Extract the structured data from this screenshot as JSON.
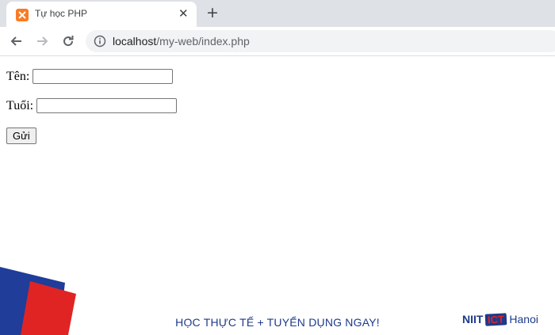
{
  "browser": {
    "tab": {
      "title": "Tự học PHP",
      "favicon": "xampp-icon",
      "close_symbol": "✕"
    },
    "new_tab_symbol": "+",
    "url_host": "localhost",
    "url_path": "/my-web/index.php"
  },
  "form": {
    "name_label": "Tên:",
    "name_value": "",
    "age_label": "Tuổi:",
    "age_value": "",
    "submit_label": "Gửi"
  },
  "footer": {
    "tagline": "HỌC THỰC TẾ + TUYỂN DỤNG NGAY!",
    "logo_part1": "NIIT",
    "logo_badge": "ICT",
    "logo_part2": "Hanoi",
    "colors": {
      "navy": "#1e3a8a",
      "red": "#e02424",
      "blue": "#1f3d99"
    }
  }
}
